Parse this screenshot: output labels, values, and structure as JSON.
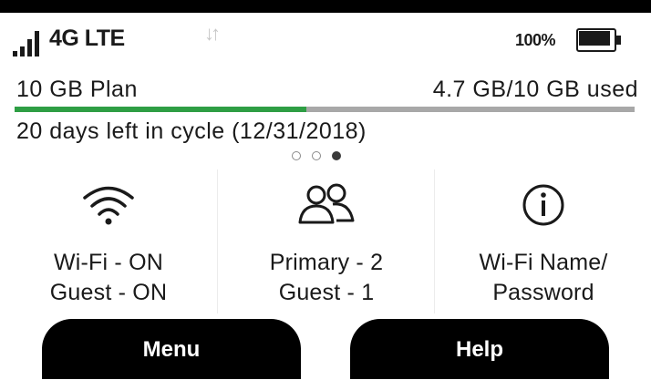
{
  "status_bar": {
    "signal_icon": "signal-bars-icon",
    "network": "4G LTE",
    "data_arrows_icon": "up-down-arrows-icon",
    "battery_percent": "100%",
    "battery_icon": "battery-full-icon"
  },
  "plan": {
    "name": "10 GB Plan",
    "used_text": "4.7 GB/10 GB used",
    "used_fraction": 0.47,
    "cycle_text": "20 days left in cycle (12/31/2018)"
  },
  "pager": {
    "count": 3,
    "active_index": 2
  },
  "tiles": [
    {
      "icon": "wifi-icon",
      "line1": "Wi-Fi - ON",
      "line2": "Guest - ON"
    },
    {
      "icon": "users-icon",
      "line1": "Primary - 2",
      "line2": "Guest - 1"
    },
    {
      "icon": "info-icon",
      "line1": "Wi-Fi Name/",
      "line2": "Password"
    }
  ],
  "buttons": {
    "menu_label": "Menu",
    "help_label": "Help"
  },
  "colors": {
    "usage_fill": "#2e9e44",
    "usage_track": "#a8a8a8",
    "button_bg": "#000000",
    "button_text": "#ffffff"
  }
}
